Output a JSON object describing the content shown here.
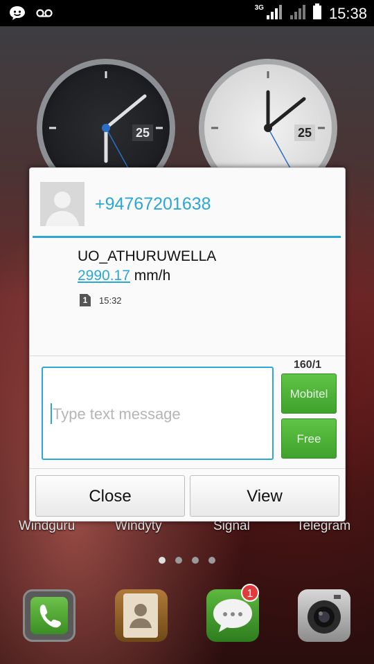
{
  "status_bar": {
    "time": "15:38",
    "network": "3G",
    "icons": [
      "smiley-icon",
      "voicemail-icon",
      "signal-icon",
      "signal-icon",
      "battery-icon"
    ]
  },
  "home": {
    "clocks": [
      {
        "date": "25"
      },
      {
        "date": "25"
      }
    ],
    "labels": [
      "Windguru",
      "Windyty",
      "Signal",
      "Telegram"
    ],
    "page_dots": 4,
    "active_page": 0,
    "dock_badge": "1",
    "dock_icons": [
      "phone-icon",
      "contacts-icon",
      "messaging-icon",
      "camera-icon"
    ]
  },
  "dialog": {
    "phone_number": "+94767201638",
    "message": {
      "sender": "UO_ATHURUWELLA",
      "value": "2990.17",
      "unit": " mm/h",
      "sim_slot": "1",
      "time": "15:32"
    },
    "counter": "160/1",
    "input": {
      "placeholder": "Type text message",
      "value": ""
    },
    "send_buttons": {
      "mobitel": "Mobitel",
      "free": "Free"
    },
    "buttons": {
      "close": "Close",
      "view": "View"
    }
  },
  "colors": {
    "accent": "#2aa7d5",
    "send_green": "#4cb437"
  }
}
